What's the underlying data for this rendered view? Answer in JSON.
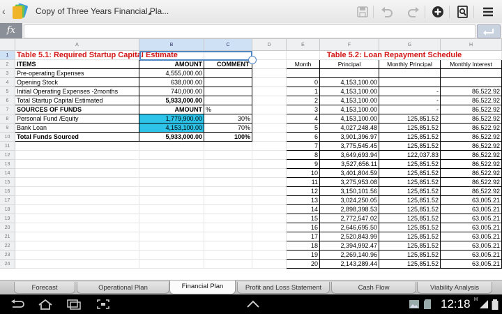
{
  "header": {
    "title": "Copy of Three Years Financial Pla..."
  },
  "formula_bar": {
    "fx_label": "fx",
    "value": ""
  },
  "columns": [
    "A",
    "B",
    "C",
    "D",
    "E",
    "F",
    "G",
    "H"
  ],
  "rows": [
    "1",
    "2",
    "3",
    "4",
    "5",
    "6",
    "7",
    "8",
    "9",
    "10",
    "11",
    "12",
    "13",
    "14",
    "15",
    "16",
    "17",
    "18",
    "19",
    "20",
    "21",
    "22",
    "23",
    "24"
  ],
  "table51": {
    "title": "Table 5.1: Required Startup Capital Estimate",
    "items_header": "ITEMS",
    "amount_header": "AMOUNT",
    "comment_header": "COMMENT",
    "items": [
      {
        "label": "Pre-operating Expenses",
        "amount": "4,555,000.00"
      },
      {
        "label": "Opening Stock",
        "amount": "638,000.00"
      },
      {
        "label": "Initial Operating Expenses -2months",
        "amount": "740,000.00"
      }
    ],
    "total_label": "Total Startup Capital Estimated",
    "total_amount": "5,933,000.00",
    "sources_header": "SOURCES OF FUNDS",
    "sources_amount_header": "AMOUNT",
    "pct_header": "%",
    "sources": [
      {
        "label": "Personal Fund /Equity",
        "amount": "1,779,900.00",
        "pct": "30%"
      },
      {
        "label": "Bank Loan",
        "amount": "4,153,100.00",
        "pct": "70%"
      }
    ],
    "funds_total_label": "Total Funds Sourced",
    "funds_total_amount": "5,933,000.00",
    "funds_total_pct": "100%"
  },
  "table52": {
    "title": "Table 5.2: Loan Repayment Schedule",
    "headers": [
      "Month",
      "Principal",
      "Monthly Principal",
      "Monthly Interest"
    ],
    "rows": [
      [
        "",
        "",
        "",
        ""
      ],
      [
        "0",
        "4,153,100.00",
        "",
        ""
      ],
      [
        "1",
        "4,153,100.00",
        "-",
        "86,522.92"
      ],
      [
        "2",
        "4,153,100.00",
        "-",
        "86,522.92"
      ],
      [
        "3",
        "4,153,100.00",
        "-",
        "86,522.92"
      ],
      [
        "4",
        "4,153,100.00",
        "125,851.52",
        "86,522.92"
      ],
      [
        "5",
        "4,027,248.48",
        "125,851.52",
        "86,522.92"
      ],
      [
        "6",
        "3,901,396.97",
        "125,851.52",
        "86,522.92"
      ],
      [
        "7",
        "3,775,545.45",
        "125,851.52",
        "86,522.92"
      ],
      [
        "8",
        "3,649,693.94",
        "122,037.83",
        "86,522.92"
      ],
      [
        "9",
        "3,527,656.11",
        "125,851.52",
        "86,522.92"
      ],
      [
        "10",
        "3,401,804.59",
        "125,851.52",
        "86,522.92"
      ],
      [
        "11",
        "3,275,953.08",
        "125,851.52",
        "86,522.92"
      ],
      [
        "12",
        "3,150,101.56",
        "125,851.52",
        "86,522.92"
      ],
      [
        "13",
        "3,024,250.05",
        "125,851.52",
        "63,005.21"
      ],
      [
        "14",
        "2,898,398.53",
        "125,851.52",
        "63,005.21"
      ],
      [
        "15",
        "2,772,547.02",
        "125,851.52",
        "63,005.21"
      ],
      [
        "16",
        "2,646,695.50",
        "125,851.52",
        "63,005.21"
      ],
      [
        "17",
        "2,520,843.99",
        "125,851.52",
        "63,005.21"
      ],
      [
        "18",
        "2,394,992.47",
        "125,851.52",
        "63,005.21"
      ],
      [
        "19",
        "2,269,140.96",
        "125,851.52",
        "63,005.21"
      ],
      [
        "20",
        "2,143,289.44",
        "125,851.52",
        "63,005.21"
      ]
    ]
  },
  "tabs": [
    "Forecast",
    "Operational Plan",
    "Financial Plan",
    "Profit and Loss Statement",
    "Cash Flow",
    "Viability Analysis"
  ],
  "active_tab": "Financial Plan",
  "status": {
    "time": "12:18",
    "signal": "H"
  },
  "colors": {
    "selection": "#4f86c6",
    "highlight": "#2ec3e8",
    "title_red": "#d31515"
  },
  "icons": [
    "back-icon",
    "app-icon",
    "save-icon",
    "undo-icon",
    "redo-icon",
    "add-icon",
    "find-icon",
    "menu-icon",
    "enter-icon",
    "nav-back-icon",
    "home-icon",
    "recent-apps-icon",
    "screenshot-icon",
    "up-arrow-icon",
    "gallery-icon",
    "sd-card-icon",
    "signal-icon",
    "battery-icon"
  ]
}
